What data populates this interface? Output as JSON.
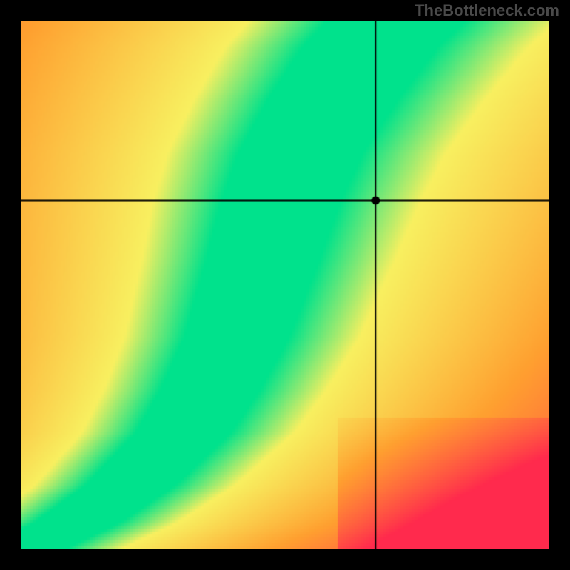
{
  "watermark": "TheBottleneck.com",
  "chart_data": {
    "type": "heatmap",
    "title": "",
    "xlabel": "",
    "ylabel": "",
    "xlim": [
      0,
      1
    ],
    "ylim": [
      0,
      1
    ],
    "marker": {
      "x": 0.672,
      "y": 0.66
    },
    "crosshair": {
      "x": 0.672,
      "y": 0.66
    },
    "colors": {
      "optimal": "#00E28C",
      "near": "#F8F060",
      "mid": "#FFA030",
      "far": "#FF2A4D"
    },
    "optimal_curve": [
      {
        "x": 0.0,
        "y": 0.0
      },
      {
        "x": 0.1,
        "y": 0.05
      },
      {
        "x": 0.2,
        "y": 0.12
      },
      {
        "x": 0.3,
        "y": 0.22
      },
      {
        "x": 0.35,
        "y": 0.3
      },
      {
        "x": 0.4,
        "y": 0.4
      },
      {
        "x": 0.45,
        "y": 0.55
      },
      {
        "x": 0.48,
        "y": 0.65
      },
      {
        "x": 0.52,
        "y": 0.75
      },
      {
        "x": 0.58,
        "y": 0.85
      },
      {
        "x": 0.65,
        "y": 0.95
      },
      {
        "x": 0.7,
        "y": 1.0
      }
    ],
    "band_width": 0.06,
    "grid_resolution": 185,
    "description": "Heatmap showing bottleneck severity. Green curved band from bottom-left toward upper area indicates balanced configurations. Red regions (far left, far right, bottom-right) indicate severe bottleneck. Black crosshair marks a specific point right of the green band in the yellow-orange zone."
  }
}
